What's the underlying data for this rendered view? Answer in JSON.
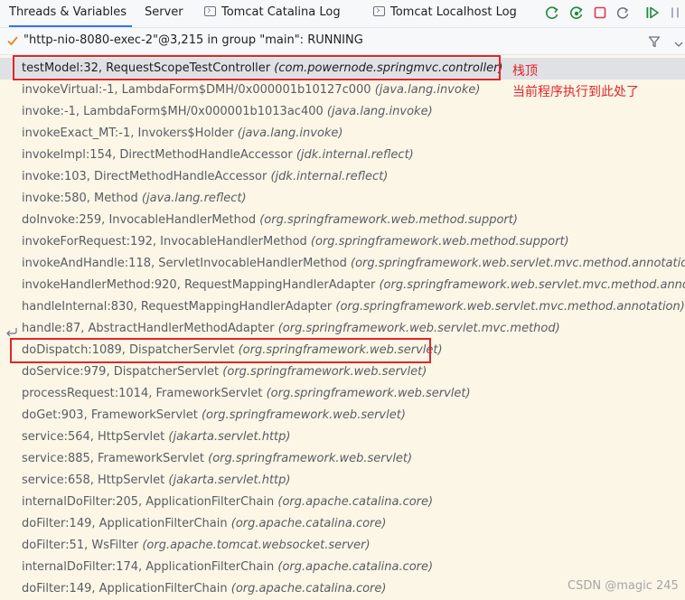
{
  "tabs": [
    {
      "label": "Threads & Variables",
      "active": true
    },
    {
      "label": "Server",
      "active": false
    },
    {
      "label": "Tomcat Catalina Log",
      "active": false
    },
    {
      "label": "Tomcat Localhost Log",
      "active": false
    }
  ],
  "toolbar": {
    "icons": [
      "rerun-icon",
      "rerun-debug-icon",
      "stop-icon",
      "restart-icon",
      "resume-icon",
      "pause-icon"
    ],
    "colors": {
      "green": "#208a3c",
      "red": "#db3b4b"
    }
  },
  "thread": {
    "label": "\"http-nio-8080-exec-2\"@3,215 in group \"main\": RUNNING"
  },
  "frames": [
    {
      "method": "testModel:32, RequestScopeTestController",
      "pkg": "(com.powernode.springmvc.controller)"
    },
    {
      "method": "invokeVirtual:-1, LambdaForm$DMH/0x000001b10127c000",
      "pkg": "(java.lang.invoke)"
    },
    {
      "method": "invoke:-1, LambdaForm$MH/0x000001b1013ac400",
      "pkg": "(java.lang.invoke)"
    },
    {
      "method": "invokeExact_MT:-1, Invokers$Holder",
      "pkg": "(java.lang.invoke)"
    },
    {
      "method": "invokeImpl:154, DirectMethodHandleAccessor",
      "pkg": "(jdk.internal.reflect)"
    },
    {
      "method": "invoke:103, DirectMethodHandleAccessor",
      "pkg": "(jdk.internal.reflect)"
    },
    {
      "method": "invoke:580, Method",
      "pkg": "(java.lang.reflect)"
    },
    {
      "method": "doInvoke:259, InvocableHandlerMethod",
      "pkg": "(org.springframework.web.method.support)"
    },
    {
      "method": "invokeForRequest:192, InvocableHandlerMethod",
      "pkg": "(org.springframework.web.method.support)"
    },
    {
      "method": "invokeAndHandle:118, ServletInvocableHandlerMethod",
      "pkg": "(org.springframework.web.servlet.mvc.method.annotation)"
    },
    {
      "method": "invokeHandlerMethod:920, RequestMappingHandlerAdapter",
      "pkg": "(org.springframework.web.servlet.mvc.method.annotati"
    },
    {
      "method": "handleInternal:830, RequestMappingHandlerAdapter",
      "pkg": "(org.springframework.web.servlet.mvc.method.annotation)"
    },
    {
      "method": "handle:87, AbstractHandlerMethodAdapter",
      "pkg": "(org.springframework.web.servlet.mvc.method)"
    },
    {
      "method": "doDispatch:1089, DispatcherServlet",
      "pkg": "(org.springframework.web.servlet)"
    },
    {
      "method": "doService:979, DispatcherServlet",
      "pkg": "(org.springframework.web.servlet)"
    },
    {
      "method": "processRequest:1014, FrameworkServlet",
      "pkg": "(org.springframework.web.servlet)"
    },
    {
      "method": "doGet:903, FrameworkServlet",
      "pkg": "(org.springframework.web.servlet)"
    },
    {
      "method": "service:564, HttpServlet",
      "pkg": "(jakarta.servlet.http)"
    },
    {
      "method": "service:885, FrameworkServlet",
      "pkg": "(org.springframework.web.servlet)"
    },
    {
      "method": "service:658, HttpServlet",
      "pkg": "(jakarta.servlet.http)"
    },
    {
      "method": "internalDoFilter:205, ApplicationFilterChain",
      "pkg": "(org.apache.catalina.core)"
    },
    {
      "method": "doFilter:149, ApplicationFilterChain",
      "pkg": "(org.apache.catalina.core)"
    },
    {
      "method": "doFilter:51, WsFilter",
      "pkg": "(org.apache.tomcat.websocket.server)"
    },
    {
      "method": "internalDoFilter:174, ApplicationFilterChain",
      "pkg": "(org.apache.catalina.core)"
    },
    {
      "method": "doFilter:149, ApplicationFilterChain",
      "pkg": "(org.apache.catalina.core)"
    }
  ],
  "annotations": {
    "stack_top": "栈顶",
    "current_position": "当前程序执行到此处了",
    "highlight_color": "#e0262a"
  },
  "watermark": "CSDN @magic 245"
}
